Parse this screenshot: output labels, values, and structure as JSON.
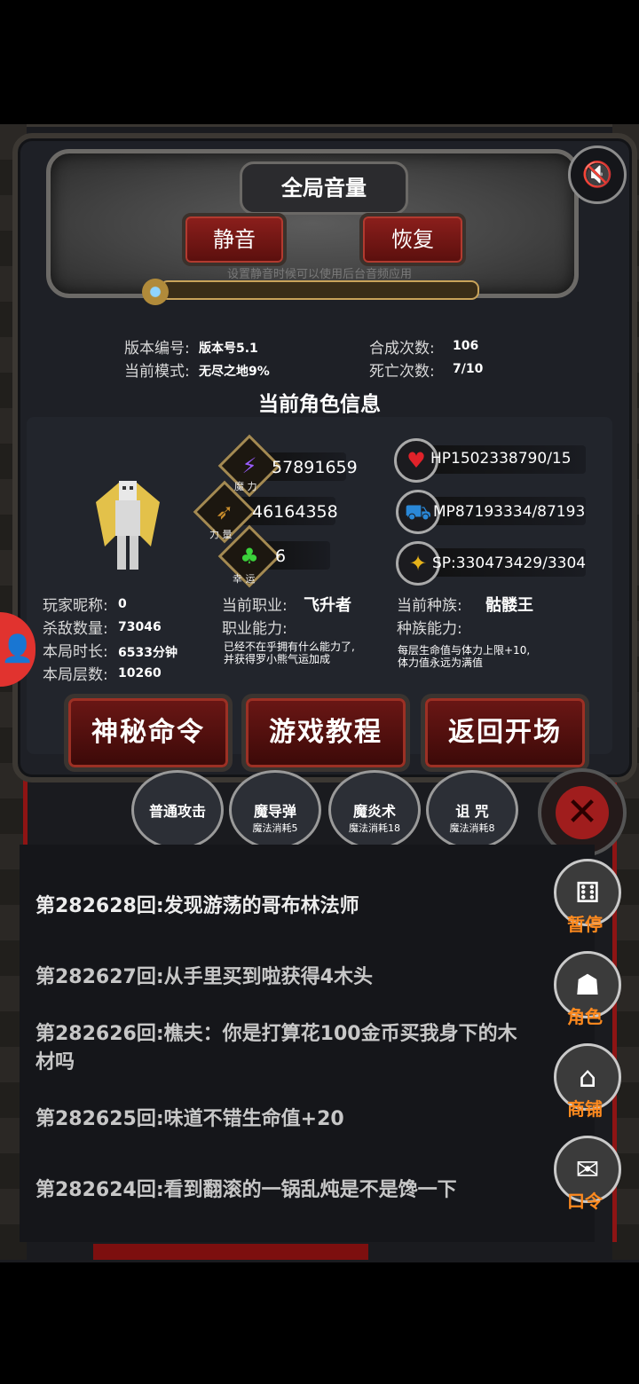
{
  "volume": {
    "title": "全局音量",
    "mute_label": "静音",
    "restore_label": "恢复",
    "hint": "设置静音时候可以使用后台音频应用",
    "level": 0.0
  },
  "info": {
    "version_label": "版本编号:",
    "version_value": "版本号5.1",
    "mode_label": "当前模式:",
    "mode_value": "无尽之地9%",
    "synth_label": "合成次数:",
    "synth_value": "106",
    "death_label": "死亡次数:",
    "death_value": "7/10"
  },
  "character": {
    "section_title": "当前角色信息",
    "magic_sub": "魔 力",
    "magic_value": "57891659",
    "strength_sub": "力 量",
    "strength_value": "46164358",
    "luck_sub": "幸 运",
    "luck_value": "6",
    "hp_text": "HP1502338790/15",
    "mp_text": "MP87193334/87193",
    "sp_text": "SP:330473429/3304",
    "nickname_label": "玩家昵称:",
    "nickname_value": "0",
    "kills_label": "杀敌数量:",
    "kills_value": "73046",
    "time_label": "本局时长:",
    "time_value": "6533分钟",
    "floors_label": "本局层数:",
    "floors_value": "10260",
    "job_label": "当前职业:",
    "job_value": "飞升者",
    "job_ability_label": "职业能力:",
    "job_ability_desc1": "已经不在乎拥有什么能力了,",
    "job_ability_desc2": "并获得罗小熊气运加成",
    "race_label": "当前种族:",
    "race_value": "骷髅王",
    "race_ability_label": "种族能力:",
    "race_ability_desc1": "每层生命值与体力上限+10,",
    "race_ability_desc2": "体力值永远为满值"
  },
  "buttons": {
    "secret": "神秘命令",
    "tutorial": "游戏教程",
    "back": "返回开场"
  },
  "skills": [
    {
      "name": "普通攻击",
      "cost": ""
    },
    {
      "name": "魔导弹",
      "cost": "魔法消耗5"
    },
    {
      "name": "魔炎术",
      "cost": "魔法消耗18"
    },
    {
      "name": "诅 咒",
      "cost": "魔法消耗8"
    }
  ],
  "logs": [
    "第282628回:发现游荡的哥布林法师",
    "第282627回:从手里买到啦获得4木头",
    "第282626回:樵夫：你是打算花100金币买我身下的木材吗",
    "第282625回:味道不错生命值+20",
    "第282624回:看到翻滚的一锅乱炖是不是馋一下"
  ],
  "side_menu": {
    "pause": "暂停",
    "role": "角色",
    "shop": "商铺",
    "password": "口令"
  },
  "colors": {
    "accent_red": "#8e1414",
    "side_label": "#ff8a1e"
  }
}
